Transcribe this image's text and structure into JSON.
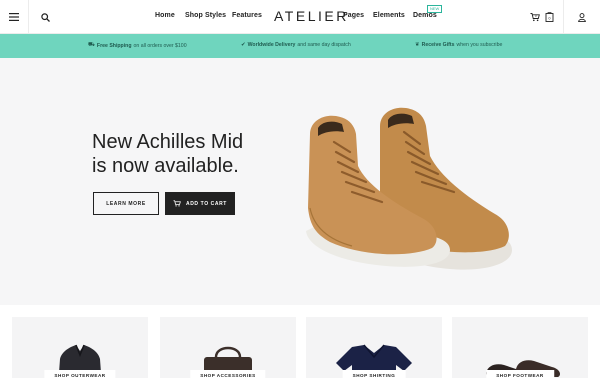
{
  "header": {
    "brand": "ATELIER",
    "nav_left": [
      "Home",
      "Shop Styles",
      "Features"
    ],
    "nav_right": [
      "Pages",
      "Elements",
      "Demos"
    ],
    "new_badge": "NEW",
    "icons": [
      "menu-icon",
      "search-icon",
      "cart-icon",
      "wishlist-icon",
      "user-icon"
    ],
    "cart_count": "0",
    "wishlist_count": "0"
  },
  "promo": {
    "items": [
      {
        "icon": "truck-icon",
        "bold": "Free Shipping",
        "text": "on all orders over $100"
      },
      {
        "icon": "check-icon",
        "bold": "Worldwide Delivery",
        "text": "and same day dispatch"
      },
      {
        "icon": "gift-icon",
        "bold": "Receive Gifts",
        "text": "when you subscribe"
      }
    ]
  },
  "hero": {
    "title_line1": "New Achilles Mid",
    "title_line2": "is now available.",
    "learn_more": "LEARN MORE",
    "add_to_cart": "ADD TO CART"
  },
  "categories": [
    {
      "label": "SHOP OUTERWEAR"
    },
    {
      "label": "SHOP ACCESSORIES"
    },
    {
      "label": "SHOP SHIRTING"
    },
    {
      "label": "SHOP FOOTWEAR"
    }
  ],
  "colors": {
    "promo_bg": "#6fd5be",
    "hero_bg": "#f6f6f7",
    "dark": "#222222",
    "suede": "#c08a4a"
  }
}
